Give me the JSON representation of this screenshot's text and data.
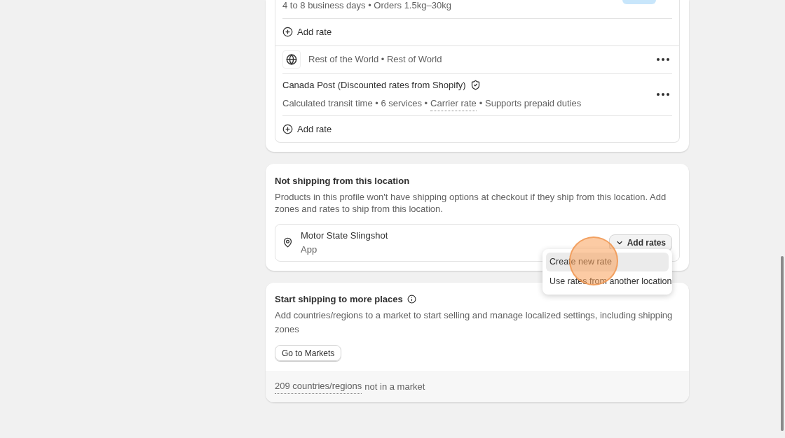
{
  "zone_card": {
    "rate_detail": "4 to 8 business days • Orders 1.5kg–30kg",
    "add_rate_1": "Add rate",
    "zone_name": "Rest of the World • Rest of World",
    "carrier": {
      "name": "Canada Post (Discounted rates from Shopify)",
      "detail_before": "Calculated transit time • 6 services •",
      "detail_link": "Carrier rate",
      "detail_after": "• Supports prepaid duties"
    },
    "add_rate_2": "Add rate"
  },
  "not_shipping": {
    "title": "Not shipping from this location",
    "description": "Products in this profile won't have shipping options at checkout if they ship from this location. Add zones and rates to ship from this location.",
    "location": {
      "name": "Motor State Slingshot",
      "subtitle": "App"
    },
    "add_rates_button": "Add rates",
    "menu": [
      {
        "label": "Create new rate",
        "selected": true
      },
      {
        "label": "Use rates from another location",
        "selected": false
      }
    ]
  },
  "more_places": {
    "title": "Start shipping to more places",
    "description": "Add countries/regions to a market to start selling and manage localized settings, including shipping zones",
    "button": "Go to Markets",
    "footer_link": "209 countries/regions",
    "footer_text": "not in a market"
  }
}
